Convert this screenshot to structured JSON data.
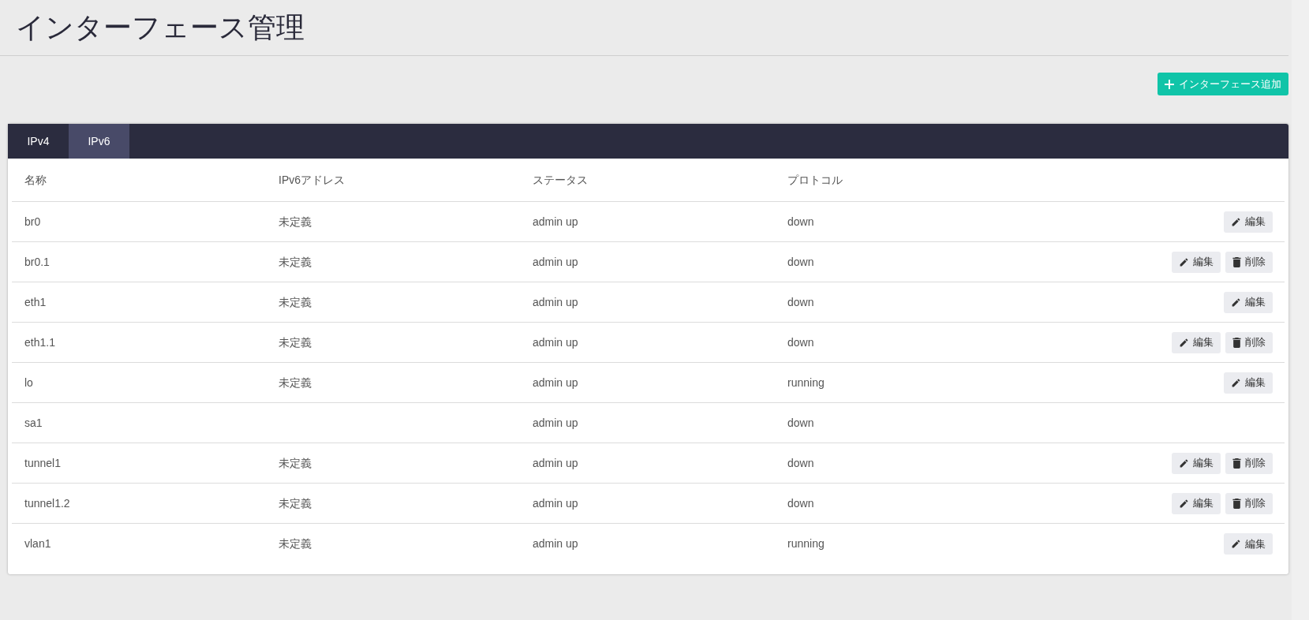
{
  "page_title": "インターフェース管理",
  "add_button": {
    "label": "インターフェース追加"
  },
  "tabs": [
    {
      "label": "IPv4",
      "selected": false
    },
    {
      "label": "IPv6",
      "selected": true
    }
  ],
  "table": {
    "columns": [
      "名称",
      "IPv6アドレス",
      "ステータス",
      "プロトコル"
    ],
    "rows": [
      {
        "cells": [
          "br0",
          "未定義",
          "admin up",
          "down"
        ],
        "actions": [
          {
            "kind": "edit",
            "label": "編集"
          }
        ]
      },
      {
        "cells": [
          "br0.1",
          "未定義",
          "admin up",
          "down"
        ],
        "actions": [
          {
            "kind": "edit",
            "label": "編集"
          },
          {
            "kind": "delete",
            "label": "削除"
          }
        ]
      },
      {
        "cells": [
          "eth1",
          "未定義",
          "admin up",
          "down"
        ],
        "actions": [
          {
            "kind": "edit",
            "label": "編集"
          }
        ]
      },
      {
        "cells": [
          "eth1.1",
          "未定義",
          "admin up",
          "down"
        ],
        "actions": [
          {
            "kind": "edit",
            "label": "編集"
          },
          {
            "kind": "delete",
            "label": "削除"
          }
        ]
      },
      {
        "cells": [
          "lo",
          "未定義",
          "admin up",
          "running"
        ],
        "actions": [
          {
            "kind": "edit",
            "label": "編集"
          }
        ]
      },
      {
        "cells": [
          "sa1",
          "",
          "admin up",
          "down"
        ]
      },
      {
        "cells": [
          "tunnel1",
          "未定義",
          "admin up",
          "down"
        ],
        "actions": [
          {
            "kind": "edit",
            "label": "編集"
          },
          {
            "kind": "delete",
            "label": "削除"
          }
        ]
      },
      {
        "cells": [
          "tunnel1.2",
          "未定義",
          "admin up",
          "down"
        ],
        "actions": [
          {
            "kind": "edit",
            "label": "編集"
          },
          {
            "kind": "delete",
            "label": "削除"
          }
        ]
      },
      {
        "cells": [
          "vlan1",
          "未定義",
          "admin up",
          "running"
        ],
        "actions": [
          {
            "kind": "edit",
            "label": "編集"
          }
        ]
      }
    ]
  }
}
